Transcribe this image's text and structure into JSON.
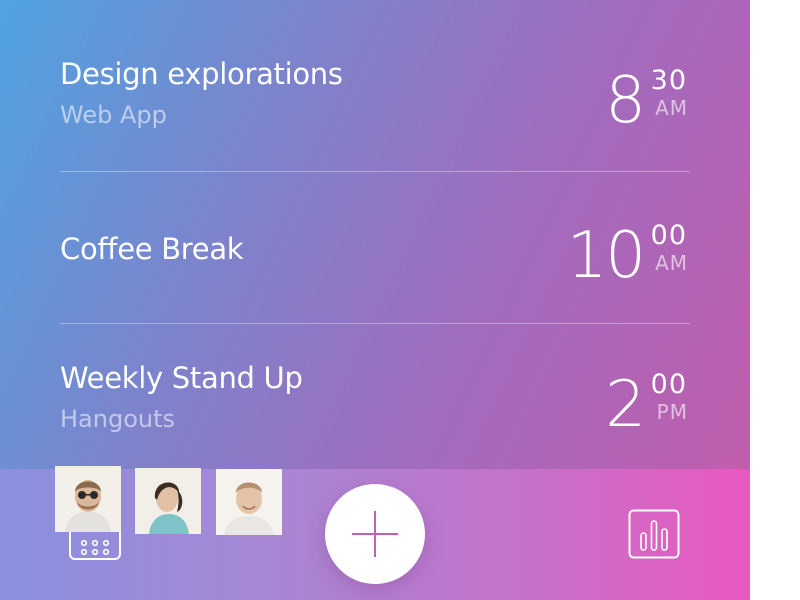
{
  "events": [
    {
      "title": "Design explorations",
      "subtitle": "Web App",
      "hour": "8",
      "minute": "30",
      "period": "AM"
    },
    {
      "title": "Coffee Break",
      "subtitle": "",
      "hour": "10",
      "minute": "00",
      "period": "AM"
    },
    {
      "title": "Weekly Stand Up",
      "subtitle": "Hangouts",
      "hour": "2",
      "minute": "00",
      "period": "PM"
    }
  ],
  "attendees": [
    {
      "icon": "man-with-sunglasses-avatar"
    },
    {
      "icon": "woman-avatar"
    },
    {
      "icon": "smiling-man-avatar"
    }
  ],
  "bottom_bar": {
    "left_icon": "calendar-icon",
    "center_icon": "plus-icon",
    "right_icon": "bar-chart-icon"
  },
  "colors": {
    "gradient_start": "#4fa3e0",
    "gradient_end": "#c65aa9",
    "bar_end": "#ea58bf",
    "accent": "#c45fb6"
  }
}
